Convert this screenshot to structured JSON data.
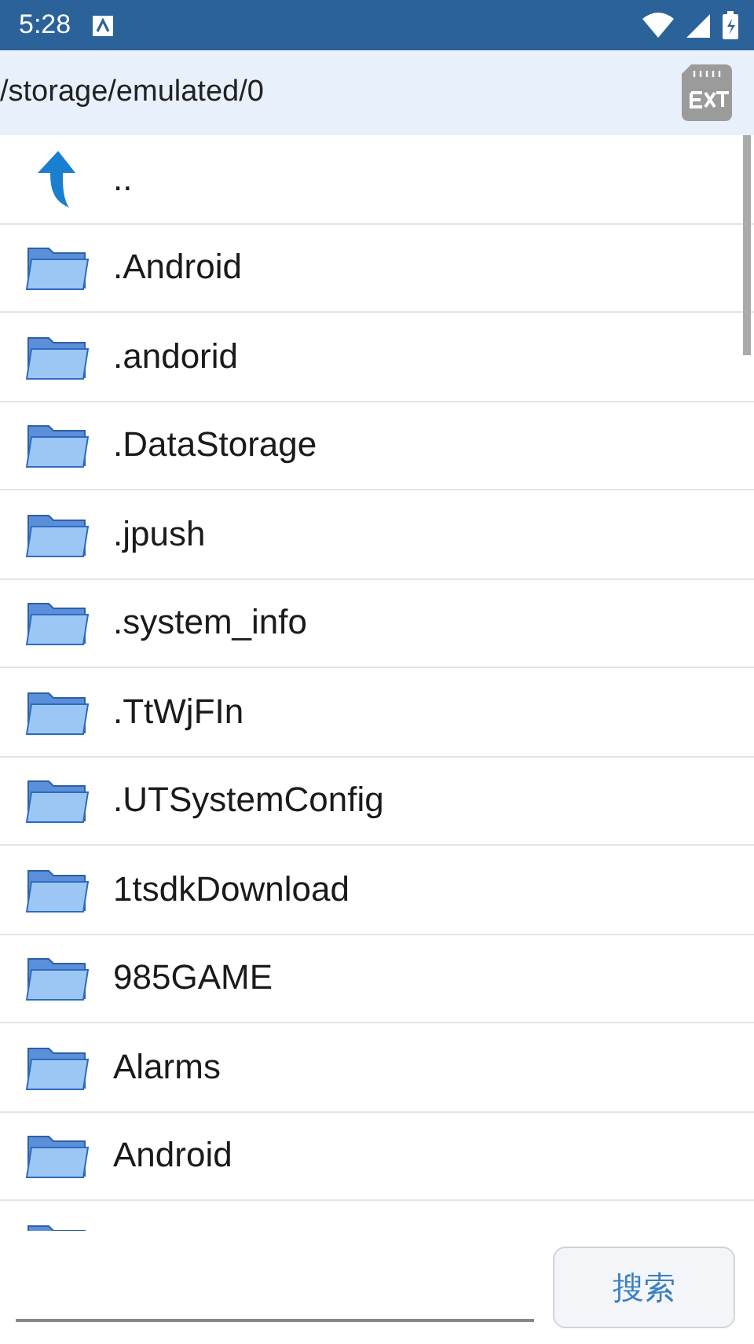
{
  "status_bar": {
    "time": "5:28"
  },
  "path_bar": {
    "path": "/storage/emulated/0"
  },
  "files": [
    {
      "kind": "parent",
      "name": ".."
    },
    {
      "kind": "folder",
      "name": ".Android"
    },
    {
      "kind": "folder",
      "name": ".andorid"
    },
    {
      "kind": "folder",
      "name": ".DataStorage"
    },
    {
      "kind": "folder",
      "name": ".jpush"
    },
    {
      "kind": "folder",
      "name": ".system_info"
    },
    {
      "kind": "folder",
      "name": ".TtWjFIn"
    },
    {
      "kind": "folder",
      "name": ".UTSystemConfig"
    },
    {
      "kind": "folder",
      "name": "1tsdkDownload"
    },
    {
      "kind": "folder",
      "name": "985GAME"
    },
    {
      "kind": "folder",
      "name": "Alarms"
    },
    {
      "kind": "folder",
      "name": "Android"
    },
    {
      "kind": "partial"
    }
  ],
  "search": {
    "button": "搜索"
  }
}
